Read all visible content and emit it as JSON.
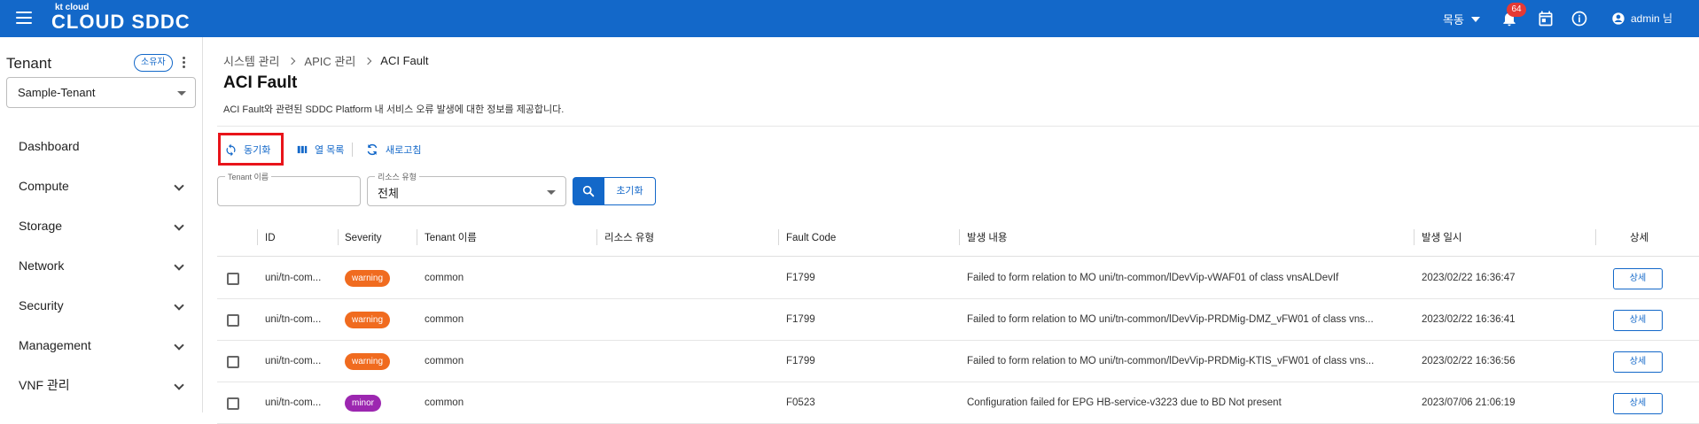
{
  "header": {
    "logo_small": "kt cloud",
    "logo_big": "CLOUD SDDC",
    "region": "목동",
    "notification_count": "64",
    "user": "admin 님"
  },
  "sidebar": {
    "tenant_title": "Tenant",
    "owner_chip": "소유자",
    "tenant_selected": "Sample-Tenant",
    "items": [
      {
        "label": "Dashboard",
        "expandable": false
      },
      {
        "label": "Compute",
        "expandable": true
      },
      {
        "label": "Storage",
        "expandable": true
      },
      {
        "label": "Network",
        "expandable": true
      },
      {
        "label": "Security",
        "expandable": true
      },
      {
        "label": "Management",
        "expandable": true
      },
      {
        "label": "VNF 관리",
        "expandable": true
      }
    ]
  },
  "breadcrumb": [
    "시스템 관리",
    "APIC 관리",
    "ACI Fault"
  ],
  "page": {
    "title": "ACI Fault",
    "description": "ACI Fault와 관련된 SDDC Platform 내 서비스 오류 발생에 대한 정보를 제공합니다."
  },
  "toolbar": {
    "sync": "동기화",
    "columns": "열 목록",
    "refresh": "새로고침"
  },
  "filters": {
    "tenant_label": "Tenant 이름",
    "tenant_value": "",
    "resource_label": "리소스 유형",
    "resource_value": "전체",
    "reset": "초기화"
  },
  "table": {
    "columns": [
      "ID",
      "Severity",
      "Tenant 이름",
      "리소스 유형",
      "Fault Code",
      "발생 내용",
      "발생 일시",
      "상세"
    ],
    "rows": [
      {
        "id": "uni/tn-com...",
        "severity": "warning",
        "tenant": "common",
        "resource": "",
        "code": "F1799",
        "content": "Failed to form relation to MO uni/tn-common/lDevVip-vWAF01 of class vnsALDevIf",
        "time": "2023/02/22 16:36:47",
        "detail": "상세"
      },
      {
        "id": "uni/tn-com...",
        "severity": "warning",
        "tenant": "common",
        "resource": "",
        "code": "F1799",
        "content": "Failed to form relation to MO uni/tn-common/lDevVip-PRDMig-DMZ_vFW01 of class vns...",
        "time": "2023/02/22 16:36:41",
        "detail": "상세"
      },
      {
        "id": "uni/tn-com...",
        "severity": "warning",
        "tenant": "common",
        "resource": "",
        "code": "F1799",
        "content": "Failed to form relation to MO uni/tn-common/lDevVip-PRDMig-KTIS_vFW01 of class vns...",
        "time": "2023/02/22 16:36:56",
        "detail": "상세"
      },
      {
        "id": "uni/tn-com...",
        "severity": "minor",
        "tenant": "common",
        "resource": "",
        "code": "F0523",
        "content": "Configuration failed for EPG HB-service-v3223 due to BD Not present",
        "time": "2023/07/06 21:06:19",
        "detail": "상세"
      }
    ]
  },
  "colors": {
    "primary": "#1368c9",
    "warning": "#f06b1f",
    "minor": "#9c27b0",
    "highlight": "#e8141a"
  }
}
